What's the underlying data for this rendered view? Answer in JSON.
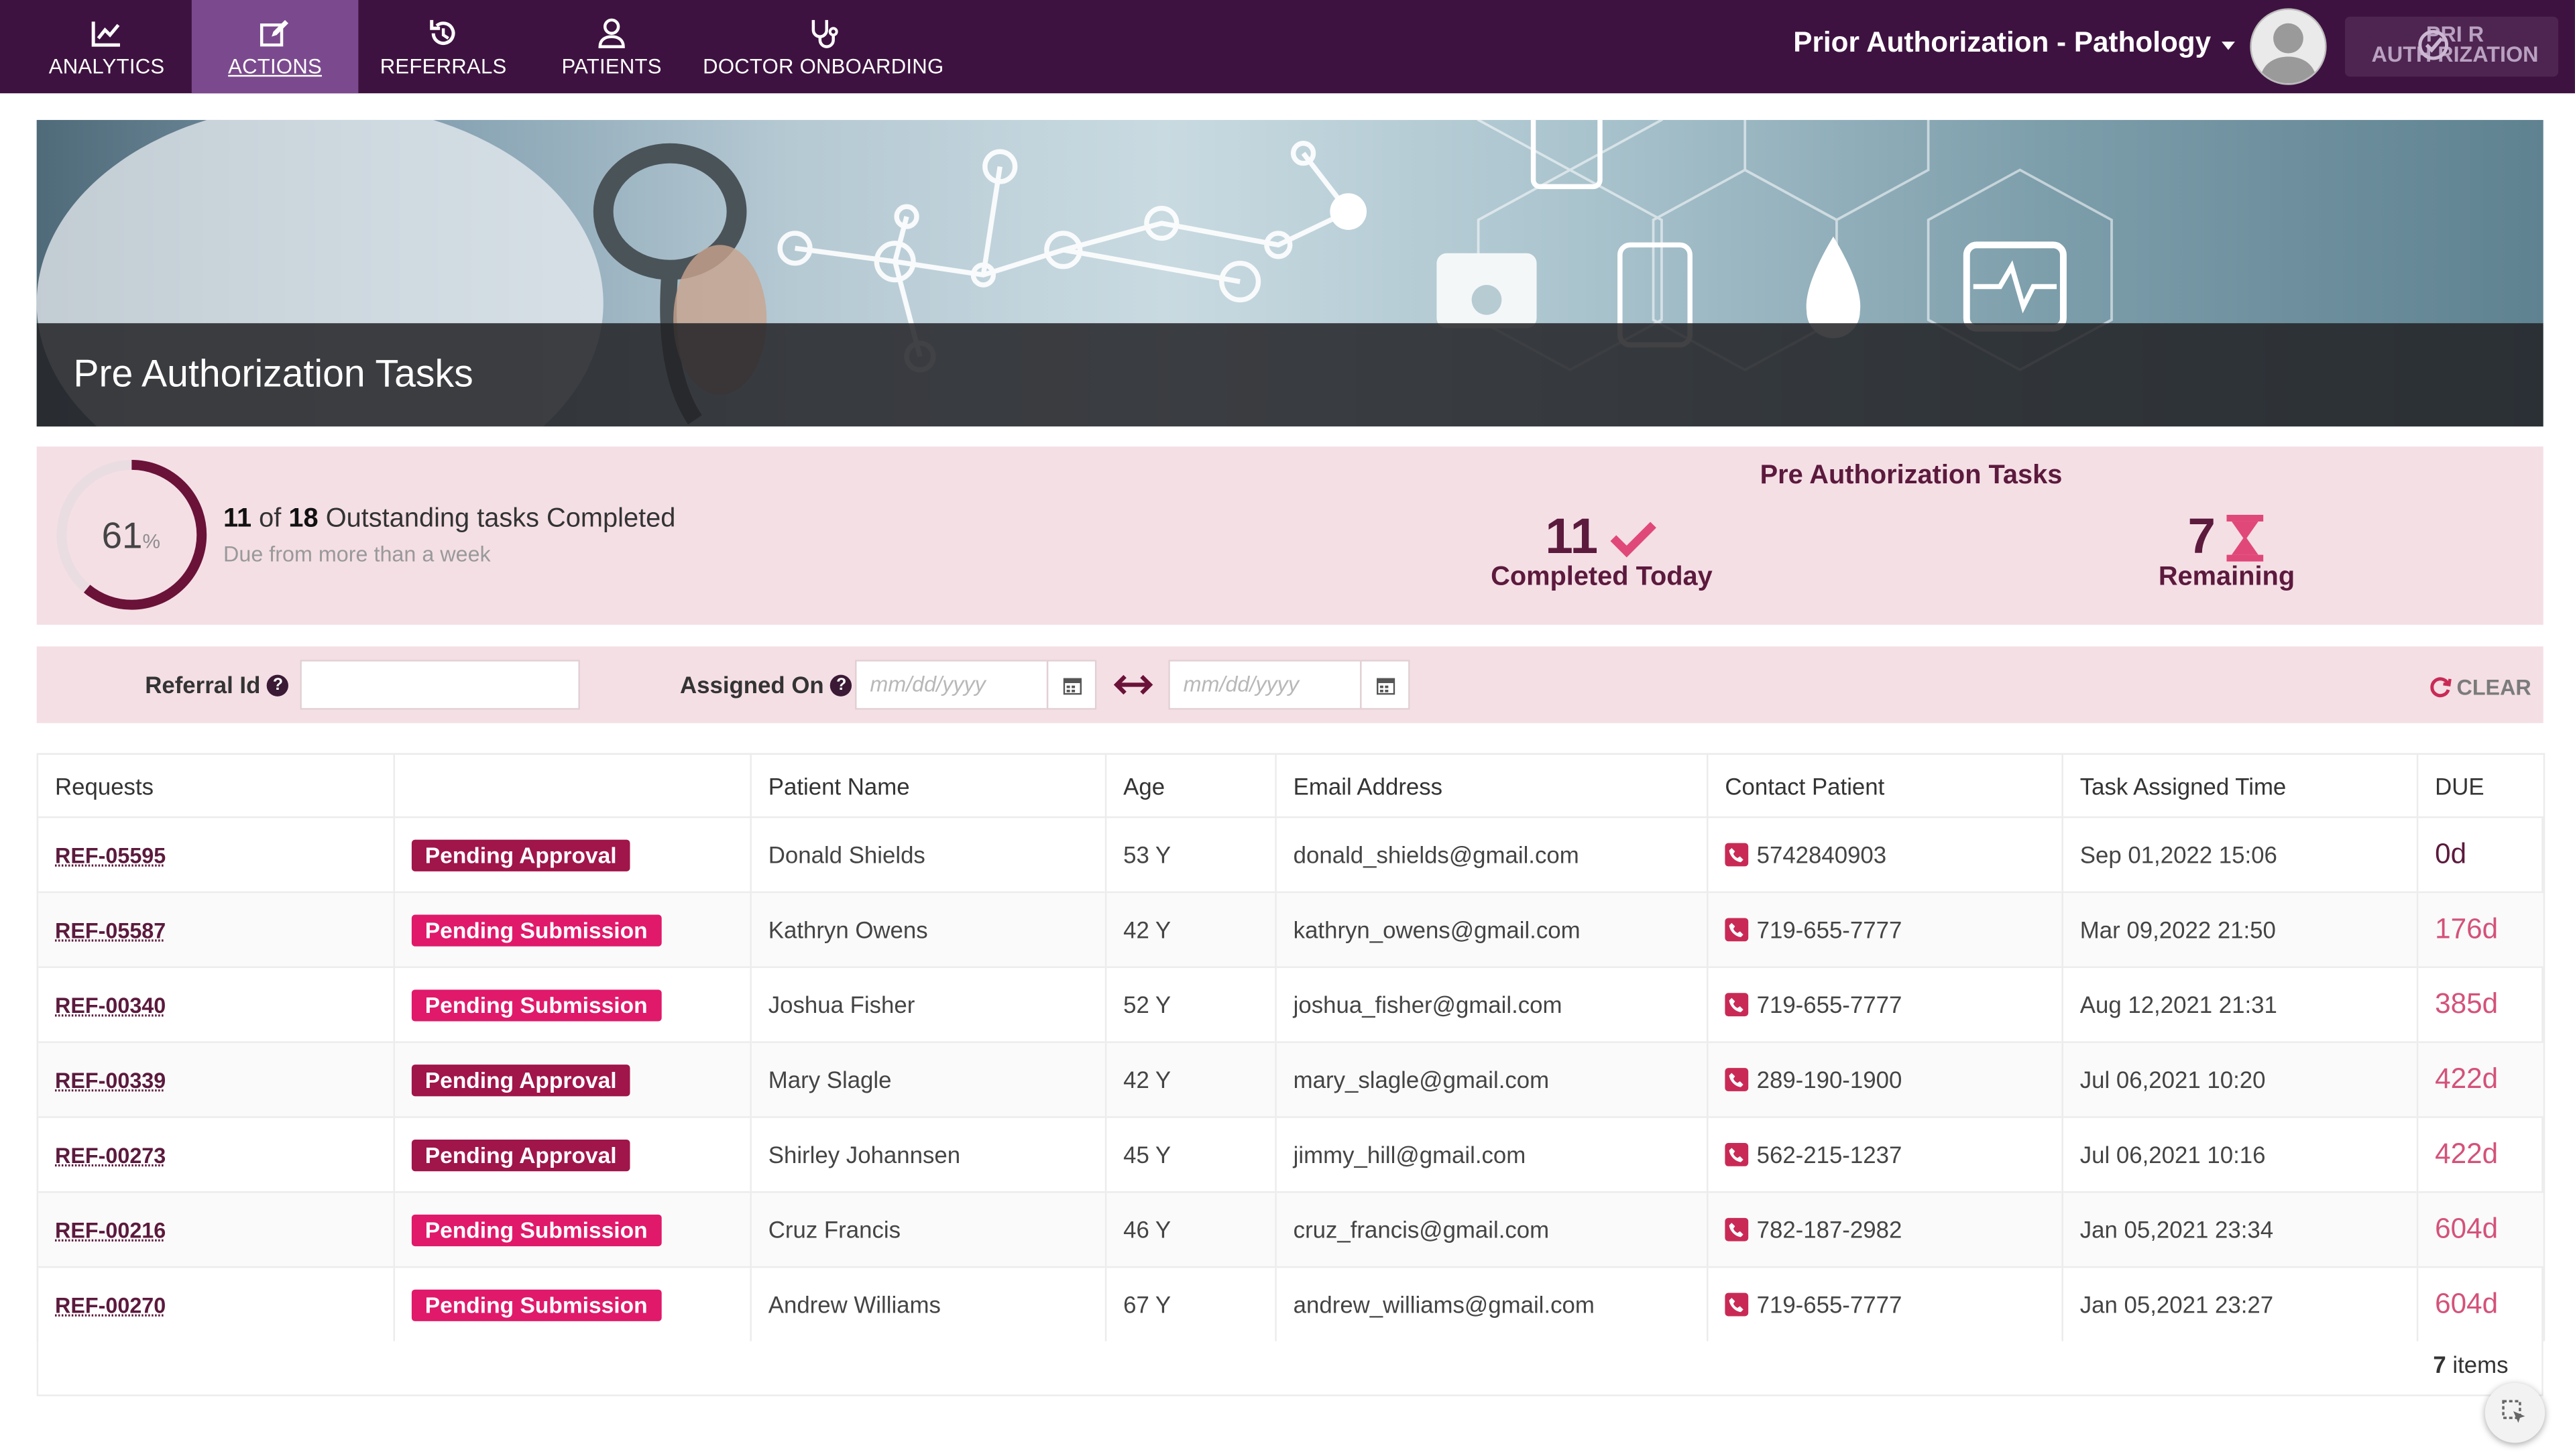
{
  "nav": {
    "items": [
      {
        "label": "ANALYTICS",
        "icon": "chart-line-icon"
      },
      {
        "label": "ACTIONS",
        "icon": "edit-icon",
        "active": true
      },
      {
        "label": "REFERRALS",
        "icon": "history-icon"
      },
      {
        "label": "PATIENTS",
        "icon": "user-icon"
      },
      {
        "label": "DOCTOR ONBOARDING",
        "icon": "stethoscope-icon"
      }
    ],
    "context_title": "Prior Authorization - Pathology",
    "logo_text_top": "PRI  R",
    "logo_text_bottom": "AUTH  RIZATION"
  },
  "banner": {
    "title": "Pre Authorization Tasks"
  },
  "stats": {
    "percent": "61",
    "percent_unit": "%",
    "percent_value": 0.61,
    "completed_count": "11",
    "of_text": "of",
    "total_count": "18",
    "outstanding_text": "Outstanding tasks Completed",
    "due_text": "Due from more than a week",
    "panel_title": "Pre Authorization Tasks",
    "completed_today_value": "11",
    "completed_today_label": "Completed Today",
    "remaining_value": "7",
    "remaining_label": "Remaining"
  },
  "filter": {
    "referral_label": "Referral Id",
    "referral_value": "",
    "assigned_label": "Assigned On",
    "date_from_placeholder": "mm/dd/yyyy",
    "date_to_placeholder": "mm/dd/yyyy",
    "clear_label": "CLEAR"
  },
  "table": {
    "headers": [
      "Requests",
      "",
      "Patient Name",
      "Age",
      "Email Address",
      "Contact Patient",
      "Task Assigned Time",
      "DUE"
    ],
    "rows": [
      {
        "ref": "REF-05595",
        "status": "Pending Approval",
        "name": "Donald Shields",
        "age": "53 Y",
        "email": "donald_shields@gmail.com",
        "phone": "5742840903",
        "assigned": "Sep 01,2022 15:06",
        "due": "0d"
      },
      {
        "ref": "REF-05587",
        "status": "Pending Submission",
        "name": "Kathryn Owens",
        "age": "42 Y",
        "email": "kathryn_owens@gmail.com",
        "phone": "719-655-7777",
        "assigned": "Mar 09,2022 21:50",
        "due": "176d"
      },
      {
        "ref": "REF-00340",
        "status": "Pending Submission",
        "name": "Joshua Fisher",
        "age": "52 Y",
        "email": "joshua_fisher@gmail.com",
        "phone": "719-655-7777",
        "assigned": "Aug 12,2021 21:31",
        "due": "385d"
      },
      {
        "ref": "REF-00339",
        "status": "Pending Approval",
        "name": "Mary Slagle",
        "age": "42 Y",
        "email": "mary_slagle@gmail.com",
        "phone": "289-190-1900",
        "assigned": "Jul 06,2021 10:20",
        "due": "422d"
      },
      {
        "ref": "REF-00273",
        "status": "Pending Approval",
        "name": "Shirley Johannsen",
        "age": "45 Y",
        "email": "jimmy_hill@gmail.com",
        "phone": "562-215-1237",
        "assigned": "Jul 06,2021 10:16",
        "due": "422d"
      },
      {
        "ref": "REF-00216",
        "status": "Pending Submission",
        "name": "Cruz Francis",
        "age": "46 Y",
        "email": "cruz_francis@gmail.com",
        "phone": "782-187-2982",
        "assigned": "Jan 05,2021 23:34",
        "due": "604d"
      },
      {
        "ref": "REF-00270",
        "status": "Pending Submission",
        "name": "Andrew Williams",
        "age": "67 Y",
        "email": "andrew_williams@gmail.com",
        "phone": "719-655-7777",
        "assigned": "Jan 05,2021 23:27",
        "due": "604d"
      }
    ],
    "items_count": "7",
    "items_label": "items"
  },
  "colors": {
    "nav_bg": "#3e1240",
    "nav_active": "#7b4a8e",
    "brand": "#5c1a3d",
    "pending_approval": "#a0154a",
    "pending_submission": "#e0196a",
    "due": "#d4527a",
    "panel_bg": "#f4dfe5"
  }
}
